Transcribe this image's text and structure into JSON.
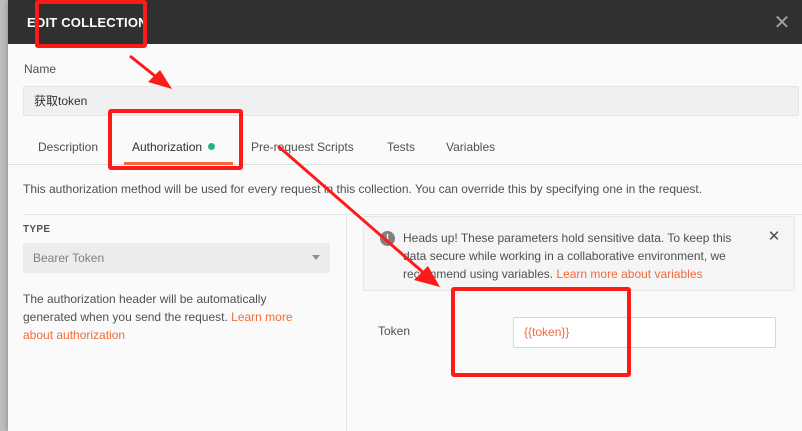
{
  "modal": {
    "title": "EDIT COLLECTION",
    "close_glyph": "✕"
  },
  "name": {
    "label": "Name",
    "value": "获取token"
  },
  "tabs": [
    {
      "label": "Description"
    },
    {
      "label": "Authorization"
    },
    {
      "label": "Pre-request Scripts"
    },
    {
      "label": "Tests"
    },
    {
      "label": "Variables"
    }
  ],
  "auth": {
    "info": "This authorization method will be used for every request in this collection. You can override this by specifying one in the request.",
    "type_label": "TYPE",
    "type_value": "Bearer Token",
    "help_text": "The authorization header will be automatically generated when you send the request. ",
    "help_link": "Learn more about authorization"
  },
  "notice": {
    "icon": "!",
    "text": "Heads up! These parameters hold sensitive data. To keep this data secure while working in a collaborative environment, we recommend using variables. ",
    "link": "Learn more about variables",
    "close_glyph": "✕"
  },
  "token": {
    "label": "Token",
    "value": "{{token}}"
  },
  "colors": {
    "accent": "#f26b3a",
    "active_dot": "#26b47f",
    "header_bg": "#303030",
    "annotation": "#ff1a1a"
  }
}
